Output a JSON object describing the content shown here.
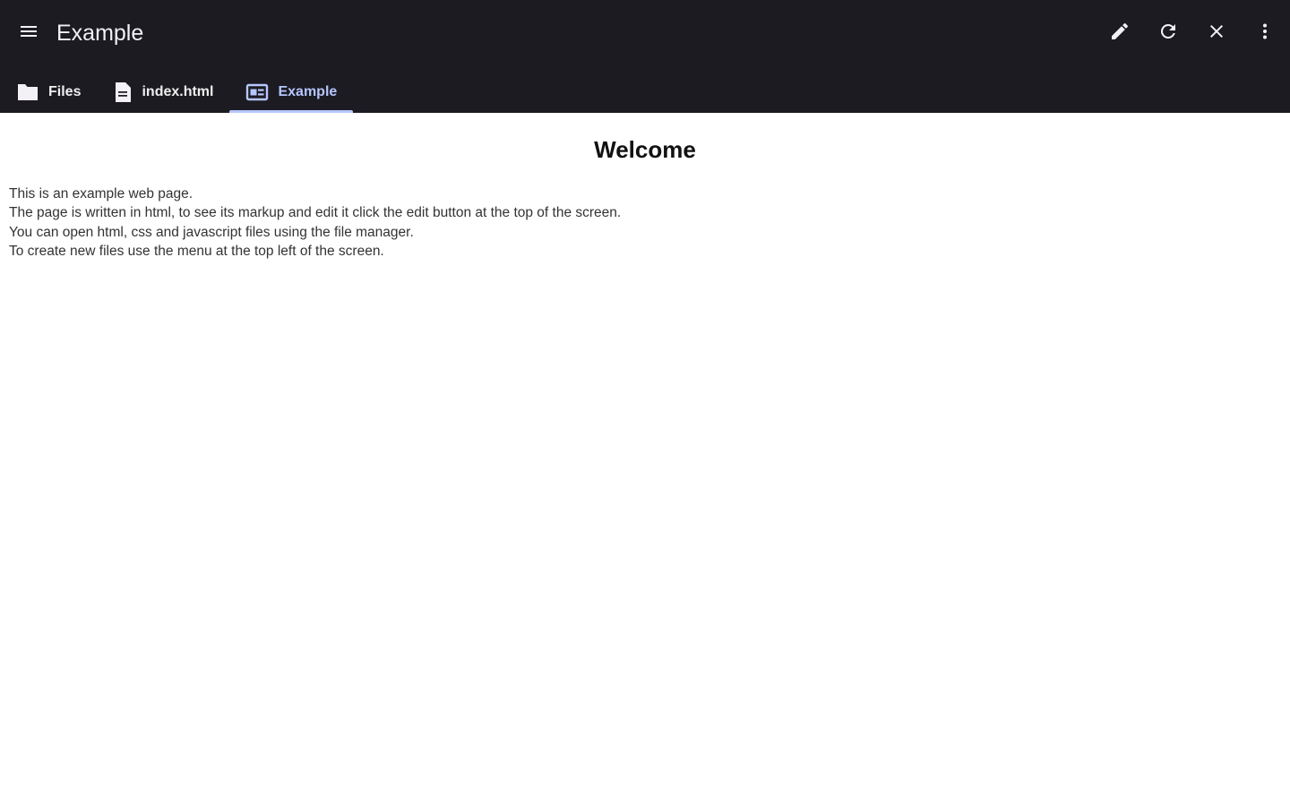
{
  "appbar": {
    "title": "Example",
    "menu_icon": "menu-icon",
    "actions": [
      {
        "name": "edit",
        "icon": "pencil-icon"
      },
      {
        "name": "reload",
        "icon": "refresh-icon"
      },
      {
        "name": "close",
        "icon": "close-icon"
      },
      {
        "name": "more",
        "icon": "more-vertical-icon"
      }
    ]
  },
  "tabs": [
    {
      "label": "Files",
      "icon": "folder-icon",
      "active": false
    },
    {
      "label": "index.html",
      "icon": "file-icon",
      "active": false
    },
    {
      "label": "Example",
      "icon": "web-preview-icon",
      "active": true
    }
  ],
  "page": {
    "heading": "Welcome",
    "lines": [
      "This is an example web page.",
      "The page is written in html, to see its markup and edit it click the edit button at the top of the screen.",
      "You can open html, css and javascript files using the file manager.",
      "To create new files use the menu at the top left of the screen."
    ]
  },
  "colors": {
    "appbar_bg": "#1c1b21",
    "tab_active": "#b6c6ff",
    "page_bg": "#ffffff"
  }
}
